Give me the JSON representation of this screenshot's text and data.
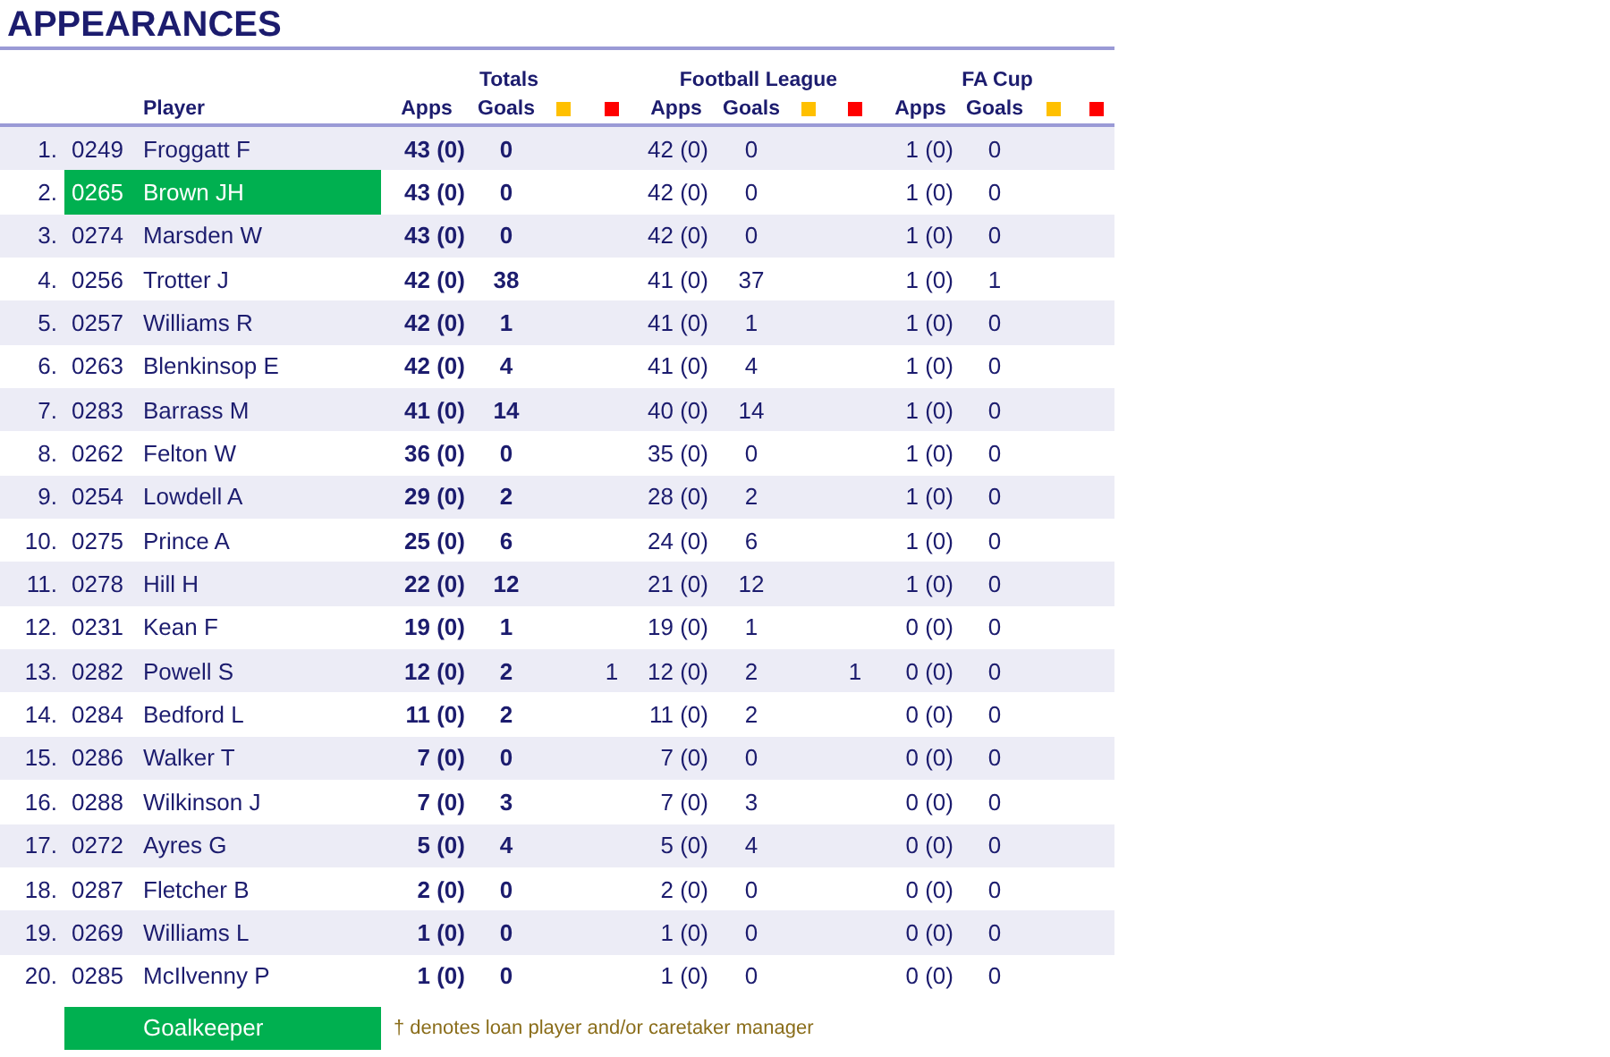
{
  "title": "APPEARANCES",
  "groups": [
    {
      "label": "Totals",
      "apps": "Apps",
      "goals": "Goals"
    },
    {
      "label": "Football League",
      "apps": "Apps",
      "goals": "Goals"
    },
    {
      "label": "FA Cup",
      "apps": "Apps",
      "goals": "Goals"
    }
  ],
  "column_headers": {
    "player": "Player"
  },
  "rows": [
    {
      "num": "1.",
      "id": "0249",
      "player": "Froggatt F",
      "goalkeeper": false,
      "totals": {
        "apps": "43 (0)",
        "goals": "0"
      },
      "league": {
        "apps": "42 (0)",
        "goals": "0"
      },
      "cup": {
        "apps": "1 (0)",
        "goals": "0"
      }
    },
    {
      "num": "2.",
      "id": "0265",
      "player": "Brown JH",
      "goalkeeper": true,
      "totals": {
        "apps": "43 (0)",
        "goals": "0"
      },
      "league": {
        "apps": "42 (0)",
        "goals": "0"
      },
      "cup": {
        "apps": "1 (0)",
        "goals": "0"
      }
    },
    {
      "num": "3.",
      "id": "0274",
      "player": "Marsden W",
      "goalkeeper": false,
      "totals": {
        "apps": "43 (0)",
        "goals": "0"
      },
      "league": {
        "apps": "42 (0)",
        "goals": "0"
      },
      "cup": {
        "apps": "1 (0)",
        "goals": "0"
      }
    },
    {
      "num": "4.",
      "id": "0256",
      "player": "Trotter J",
      "goalkeeper": false,
      "totals": {
        "apps": "42 (0)",
        "goals": "38"
      },
      "league": {
        "apps": "41 (0)",
        "goals": "37"
      },
      "cup": {
        "apps": "1 (0)",
        "goals": "1"
      }
    },
    {
      "num": "5.",
      "id": "0257",
      "player": "Williams R",
      "goalkeeper": false,
      "totals": {
        "apps": "42 (0)",
        "goals": "1"
      },
      "league": {
        "apps": "41 (0)",
        "goals": "1"
      },
      "cup": {
        "apps": "1 (0)",
        "goals": "0"
      }
    },
    {
      "num": "6.",
      "id": "0263",
      "player": "Blenkinsop E",
      "goalkeeper": false,
      "totals": {
        "apps": "42 (0)",
        "goals": "4"
      },
      "league": {
        "apps": "41 (0)",
        "goals": "4"
      },
      "cup": {
        "apps": "1 (0)",
        "goals": "0"
      }
    },
    {
      "num": "7.",
      "id": "0283",
      "player": "Barrass M",
      "goalkeeper": false,
      "totals": {
        "apps": "41 (0)",
        "goals": "14"
      },
      "league": {
        "apps": "40 (0)",
        "goals": "14"
      },
      "cup": {
        "apps": "1 (0)",
        "goals": "0"
      }
    },
    {
      "num": "8.",
      "id": "0262",
      "player": "Felton W",
      "goalkeeper": false,
      "totals": {
        "apps": "36 (0)",
        "goals": "0"
      },
      "league": {
        "apps": "35 (0)",
        "goals": "0"
      },
      "cup": {
        "apps": "1 (0)",
        "goals": "0"
      }
    },
    {
      "num": "9.",
      "id": "0254",
      "player": "Lowdell A",
      "goalkeeper": false,
      "totals": {
        "apps": "29 (0)",
        "goals": "2"
      },
      "league": {
        "apps": "28 (0)",
        "goals": "2"
      },
      "cup": {
        "apps": "1 (0)",
        "goals": "0"
      }
    },
    {
      "num": "10.",
      "id": "0275",
      "player": "Prince A",
      "goalkeeper": false,
      "totals": {
        "apps": "25 (0)",
        "goals": "6"
      },
      "league": {
        "apps": "24 (0)",
        "goals": "6"
      },
      "cup": {
        "apps": "1 (0)",
        "goals": "0"
      }
    },
    {
      "num": "11.",
      "id": "0278",
      "player": "Hill H",
      "goalkeeper": false,
      "totals": {
        "apps": "22 (0)",
        "goals": "12"
      },
      "league": {
        "apps": "21 (0)",
        "goals": "12"
      },
      "cup": {
        "apps": "1 (0)",
        "goals": "0"
      }
    },
    {
      "num": "12.",
      "id": "0231",
      "player": "Kean F",
      "goalkeeper": false,
      "totals": {
        "apps": "19 (0)",
        "goals": "1"
      },
      "league": {
        "apps": "19 (0)",
        "goals": "1"
      },
      "cup": {
        "apps": "0 (0)",
        "goals": "0"
      }
    },
    {
      "num": "13.",
      "id": "0282",
      "player": "Powell S",
      "goalkeeper": false,
      "totals": {
        "apps": "12 (0)",
        "goals": "2",
        "red": "1"
      },
      "league": {
        "apps": "12 (0)",
        "goals": "2",
        "red": "1"
      },
      "cup": {
        "apps": "0 (0)",
        "goals": "0"
      }
    },
    {
      "num": "14.",
      "id": "0284",
      "player": "Bedford L",
      "goalkeeper": false,
      "totals": {
        "apps": "11 (0)",
        "goals": "2"
      },
      "league": {
        "apps": "11 (0)",
        "goals": "2"
      },
      "cup": {
        "apps": "0 (0)",
        "goals": "0"
      }
    },
    {
      "num": "15.",
      "id": "0286",
      "player": "Walker T",
      "goalkeeper": false,
      "totals": {
        "apps": "7 (0)",
        "goals": "0"
      },
      "league": {
        "apps": "7 (0)",
        "goals": "0"
      },
      "cup": {
        "apps": "0 (0)",
        "goals": "0"
      }
    },
    {
      "num": "16.",
      "id": "0288",
      "player": "Wilkinson J",
      "goalkeeper": false,
      "totals": {
        "apps": "7 (0)",
        "goals": "3"
      },
      "league": {
        "apps": "7 (0)",
        "goals": "3"
      },
      "cup": {
        "apps": "0 (0)",
        "goals": "0"
      }
    },
    {
      "num": "17.",
      "id": "0272",
      "player": "Ayres G",
      "goalkeeper": false,
      "totals": {
        "apps": "5 (0)",
        "goals": "4"
      },
      "league": {
        "apps": "5 (0)",
        "goals": "4"
      },
      "cup": {
        "apps": "0 (0)",
        "goals": "0"
      }
    },
    {
      "num": "18.",
      "id": "0287",
      "player": "Fletcher B",
      "goalkeeper": false,
      "totals": {
        "apps": "2 (0)",
        "goals": "0"
      },
      "league": {
        "apps": "2 (0)",
        "goals": "0"
      },
      "cup": {
        "apps": "0 (0)",
        "goals": "0"
      }
    },
    {
      "num": "19.",
      "id": "0269",
      "player": "Williams L",
      "goalkeeper": false,
      "totals": {
        "apps": "1 (0)",
        "goals": "0"
      },
      "league": {
        "apps": "1 (0)",
        "goals": "0"
      },
      "cup": {
        "apps": "0 (0)",
        "goals": "0"
      }
    },
    {
      "num": "20.",
      "id": "0285",
      "player": "McIlvenny P",
      "goalkeeper": false,
      "totals": {
        "apps": "1 (0)",
        "goals": "0"
      },
      "league": {
        "apps": "1 (0)",
        "goals": "0"
      },
      "cup": {
        "apps": "0 (0)",
        "goals": "0"
      }
    }
  ],
  "legend": {
    "goalkeeper_label": "Goalkeeper",
    "note": "† denotes loan player and/or caretaker manager"
  }
}
